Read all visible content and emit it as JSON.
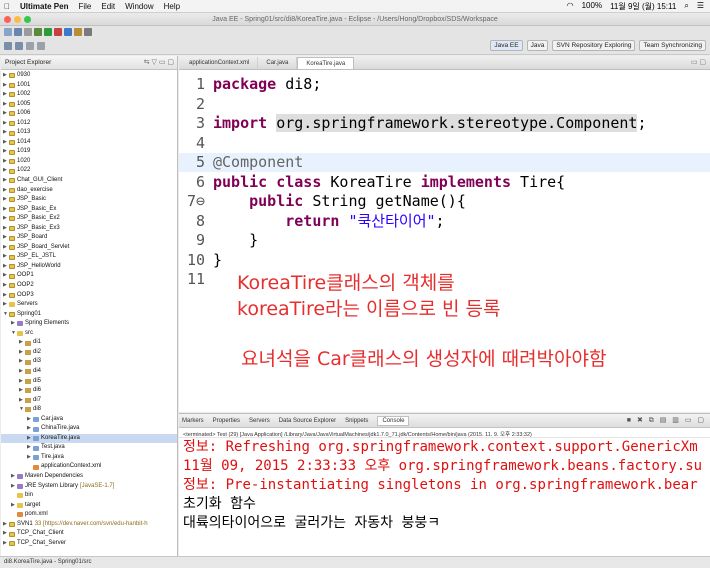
{
  "menubar": {
    "apple": "",
    "app": "Ultimate Pen",
    "items": [
      "File",
      "Edit",
      "Window",
      "Help"
    ],
    "battery": "100%",
    "date": "11월 9일 (월) 15:11"
  },
  "window": {
    "title": "Java EE - Spring01/src/di8/KoreaTire.java - Eclipse - /Users/Hong/Dropbox/SDS/Workspace"
  },
  "perspectives": [
    "Java EE",
    "Java",
    "SVN Repository Exploring",
    "Team Synchronizing"
  ],
  "explorer": {
    "title": "Project Explorer",
    "items": [
      {
        "label": "0930",
        "type": "proj",
        "depth": 0,
        "twisty": "▶"
      },
      {
        "label": "1001",
        "type": "proj",
        "depth": 0,
        "twisty": "▶"
      },
      {
        "label": "1002",
        "type": "proj",
        "depth": 0,
        "twisty": "▶"
      },
      {
        "label": "1005",
        "type": "proj",
        "depth": 0,
        "twisty": "▶"
      },
      {
        "label": "1006",
        "type": "proj",
        "depth": 0,
        "twisty": "▶"
      },
      {
        "label": "1012",
        "type": "proj",
        "depth": 0,
        "twisty": "▶"
      },
      {
        "label": "1013",
        "type": "proj",
        "depth": 0,
        "twisty": "▶"
      },
      {
        "label": "1014",
        "type": "proj",
        "depth": 0,
        "twisty": "▶"
      },
      {
        "label": "1019",
        "type": "proj",
        "depth": 0,
        "twisty": "▶"
      },
      {
        "label": "1020",
        "type": "proj",
        "depth": 0,
        "twisty": "▶"
      },
      {
        "label": "1022",
        "type": "proj",
        "depth": 0,
        "twisty": "▶"
      },
      {
        "label": "Chat_GUI_Client",
        "type": "proj",
        "depth": 0,
        "twisty": "▶"
      },
      {
        "label": "dao_exercise",
        "type": "proj",
        "depth": 0,
        "twisty": "▶"
      },
      {
        "label": "JSP_Basic",
        "type": "proj",
        "depth": 0,
        "twisty": "▶"
      },
      {
        "label": "JSP_Basic_Ex",
        "type": "proj",
        "depth": 0,
        "twisty": "▶"
      },
      {
        "label": "JSP_Basic_Ex2",
        "type": "proj",
        "depth": 0,
        "twisty": "▶"
      },
      {
        "label": "JSP_Basic_Ex3",
        "type": "proj",
        "depth": 0,
        "twisty": "▶"
      },
      {
        "label": "JSP_Board",
        "type": "proj",
        "depth": 0,
        "twisty": "▶"
      },
      {
        "label": "JSP_Board_Servlet",
        "type": "proj",
        "depth": 0,
        "twisty": "▶"
      },
      {
        "label": "JSP_EL_JSTL",
        "type": "proj",
        "depth": 0,
        "twisty": "▶"
      },
      {
        "label": "JSP_HelloWorld",
        "type": "proj",
        "depth": 0,
        "twisty": "▶"
      },
      {
        "label": "OOP1",
        "type": "proj",
        "depth": 0,
        "twisty": "▶"
      },
      {
        "label": "OOP2",
        "type": "proj",
        "depth": 0,
        "twisty": "▶"
      },
      {
        "label": "OOP3",
        "type": "proj",
        "depth": 0,
        "twisty": "▶"
      },
      {
        "label": "Servers",
        "type": "fold",
        "depth": 0,
        "twisty": "▶"
      },
      {
        "label": "Spring01",
        "type": "proj",
        "depth": 0,
        "twisty": "▼"
      },
      {
        "label": "Spring Elements",
        "type": "lib",
        "depth": 1,
        "twisty": "▶"
      },
      {
        "label": "src",
        "type": "fold",
        "depth": 1,
        "twisty": "▼"
      },
      {
        "label": "di1",
        "type": "pkg",
        "depth": 2,
        "twisty": "▶"
      },
      {
        "label": "di2",
        "type": "pkg",
        "depth": 2,
        "twisty": "▶"
      },
      {
        "label": "di3",
        "type": "pkg",
        "depth": 2,
        "twisty": "▶"
      },
      {
        "label": "di4",
        "type": "pkg",
        "depth": 2,
        "twisty": "▶"
      },
      {
        "label": "di5",
        "type": "pkg",
        "depth": 2,
        "twisty": "▶"
      },
      {
        "label": "di6",
        "type": "pkg",
        "depth": 2,
        "twisty": "▶"
      },
      {
        "label": "di7",
        "type": "pkg",
        "depth": 2,
        "twisty": "▶"
      },
      {
        "label": "di8",
        "type": "pkg",
        "depth": 2,
        "twisty": "▼"
      },
      {
        "label": "Car.java",
        "type": "file",
        "depth": 3,
        "twisty": "▶"
      },
      {
        "label": "ChinaTire.java",
        "type": "file",
        "depth": 3,
        "twisty": "▶"
      },
      {
        "label": "KoreaTire.java",
        "type": "file",
        "depth": 3,
        "twisty": "▶",
        "selected": true
      },
      {
        "label": "Test.java",
        "type": "file",
        "depth": 3,
        "twisty": "▶"
      },
      {
        "label": "Tire.java",
        "type": "file",
        "depth": 3,
        "twisty": "▶"
      },
      {
        "label": "applicationContext.xml",
        "type": "xml",
        "depth": 3,
        "twisty": ""
      },
      {
        "label": "Maven Dependencies",
        "type": "lib",
        "depth": 1,
        "twisty": "▶"
      },
      {
        "label": "JRE System Library",
        "deco": "[JavaSE-1.7]",
        "type": "lib",
        "depth": 1,
        "twisty": "▶"
      },
      {
        "label": "bin",
        "type": "fold",
        "depth": 1,
        "twisty": ""
      },
      {
        "label": "target",
        "type": "fold",
        "depth": 1,
        "twisty": "▶"
      },
      {
        "label": "pom.xml",
        "type": "xml",
        "depth": 1,
        "twisty": ""
      },
      {
        "label": "SVN1",
        "deco": "33 [https://dev.naver.com/svn/edu-hanbit-h",
        "type": "proj",
        "depth": 0,
        "twisty": "▶"
      },
      {
        "label": "TCP_Chat_Client",
        "type": "proj",
        "depth": 0,
        "twisty": "▶"
      },
      {
        "label": "TCP_Chat_Server",
        "type": "proj",
        "depth": 0,
        "twisty": "▶"
      }
    ]
  },
  "editor": {
    "tabs": [
      {
        "label": "applicationContext.xml",
        "active": false
      },
      {
        "label": "Car.java",
        "active": false
      },
      {
        "label": "KoreaTire.java",
        "active": true
      }
    ],
    "lines": [
      {
        "n": "1",
        "parts": [
          [
            "kw",
            "package"
          ],
          [
            "t",
            " di8;"
          ]
        ]
      },
      {
        "n": "2",
        "parts": []
      },
      {
        "n": "3",
        "parts": [
          [
            "kw",
            "import"
          ],
          [
            "t",
            " "
          ],
          [
            "hl",
            "org.springframework.stereotype.Component"
          ],
          [
            "t",
            ";"
          ]
        ]
      },
      {
        "n": "4",
        "parts": []
      },
      {
        "n": "5",
        "parts": [
          [
            "ann",
            "@Component"
          ]
        ],
        "current": true
      },
      {
        "n": "6",
        "parts": [
          [
            "kw",
            "public class"
          ],
          [
            "t",
            " KoreaTire "
          ],
          [
            "kw",
            "implements"
          ],
          [
            "t",
            " Tire{"
          ]
        ]
      },
      {
        "n": "7⊖",
        "parts": [
          [
            "t",
            "    "
          ],
          [
            "kw",
            "public"
          ],
          [
            "t",
            " String getName(){"
          ]
        ]
      },
      {
        "n": "8",
        "parts": [
          [
            "t",
            "        "
          ],
          [
            "kw",
            "return"
          ],
          [
            "t",
            " "
          ],
          [
            "str",
            "\"쿡산타이어\""
          ],
          [
            "t",
            ";"
          ]
        ]
      },
      {
        "n": "9",
        "parts": [
          [
            "t",
            "    }"
          ]
        ]
      },
      {
        "n": "10",
        "parts": [
          [
            "t",
            "}"
          ]
        ]
      },
      {
        "n": "11",
        "parts": []
      }
    ],
    "notes": [
      "KoreaTire클래스의 객체를",
      "koreaTire라는 이름으로 빈 등록",
      "요녀석을 Car클래스의 생성자에 때려박아야함"
    ]
  },
  "console": {
    "tabs": [
      "Markers",
      "Properties",
      "Servers",
      "Data Source Explorer",
      "Snippets",
      "Console"
    ],
    "active_tab": "Console",
    "terminated": "<terminated> Test (29) [Java Application] /Library/Java/JavaVirtualMachines/jdk1.7.0_71.jdk/Contents/Home/bin/java (2015. 11. 9. 오후 2:33:32)",
    "lines": [
      {
        "kind": "err",
        "text": "정보: Refreshing org.springframework.context.support.GenericXm"
      },
      {
        "kind": "err",
        "text": "11월 09, 2015 2:33:33 오후 org.springframework.beans.factory.su"
      },
      {
        "kind": "err",
        "text": "정보: Pre-instantiating singletons in org.springframework.bear"
      },
      {
        "kind": "std",
        "text": "초기화 함수"
      },
      {
        "kind": "std",
        "text": "대륙의타이어으로 굴러가는 자동차 붕붕ㅋ"
      }
    ]
  },
  "status": {
    "text": "di8.KoreaTire.java - Spring01/src"
  },
  "colors": {
    "keyword": "#7f0055",
    "string": "#2a00ff",
    "error": "#e01010",
    "note": "#e62e2e"
  }
}
